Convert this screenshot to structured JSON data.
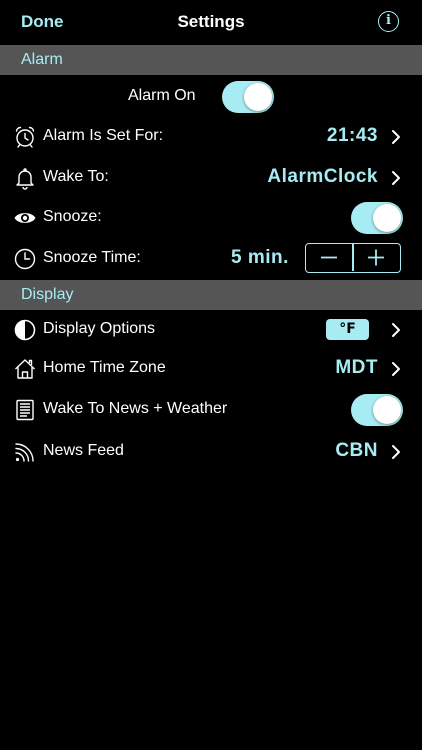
{
  "nav": {
    "done_label": "Done",
    "title": "Settings",
    "info_glyph": "i"
  },
  "sections": {
    "alarm": "Alarm",
    "display": "Display"
  },
  "alarm": {
    "alarm_on_label": "Alarm On",
    "alarm_on": true,
    "set_for_label": "Alarm Is Set For:",
    "set_for_value": "21:43",
    "wake_to_label": "Wake To:",
    "wake_to_value": "AlarmClock",
    "snooze_label": "Snooze:",
    "snooze_on": true,
    "snooze_time_label": "Snooze Time:",
    "snooze_time_value": "5 min."
  },
  "display": {
    "display_options_label": "Display Options",
    "display_options_value": "°F",
    "home_time_zone_label": "Home Time Zone",
    "home_time_zone_value": "MDT",
    "wake_news_label": "Wake To News + Weather",
    "wake_news_on": true,
    "news_feed_label": "News Feed",
    "news_feed_value": "CBN"
  },
  "icons": [
    "alarm-clock-icon",
    "bell-icon",
    "eye-icon",
    "clock-icon",
    "half-circle-icon",
    "house-icon",
    "newspaper-icon",
    "rss-feed-icon",
    "chevron-right-icon",
    "minus-icon",
    "plus-icon",
    "info-icon"
  ],
  "colors": {
    "accent": "#a8ecf3",
    "section_bg": "#555556",
    "background": "#000000"
  }
}
